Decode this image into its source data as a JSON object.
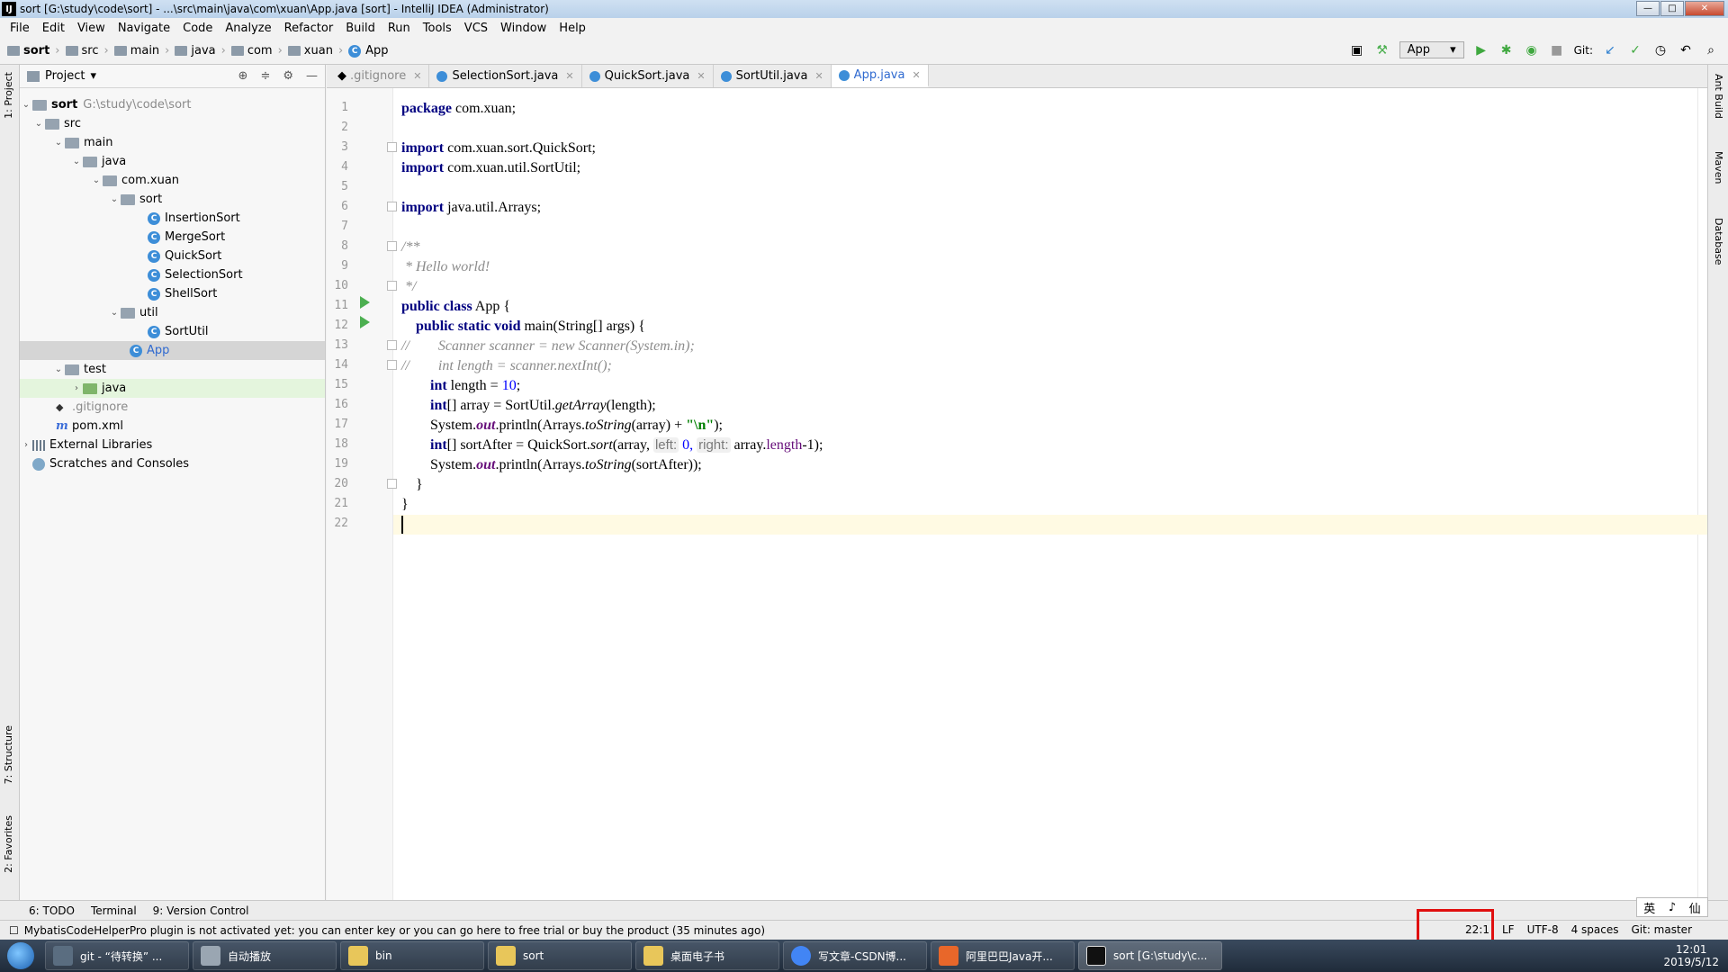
{
  "window": {
    "title": "sort [G:\\study\\code\\sort] - ...\\src\\main\\java\\com\\xuan\\App.java [sort] - IntelliJ IDEA (Administrator)"
  },
  "menu": [
    "File",
    "Edit",
    "View",
    "Navigate",
    "Code",
    "Analyze",
    "Refactor",
    "Build",
    "Run",
    "Tools",
    "VCS",
    "Window",
    "Help"
  ],
  "breadcrumbs": [
    "sort",
    "src",
    "main",
    "java",
    "com",
    "xuan",
    "App"
  ],
  "toolbar": {
    "run_config": "App",
    "git_label": "Git:"
  },
  "left_tabs": {
    "project": "1: Project",
    "structure": "7: Structure",
    "favorites": "2: Favorites"
  },
  "right_tabs": {
    "ant": "Ant Build",
    "maven": "Maven",
    "database": "Database"
  },
  "project_panel": {
    "title": "Project",
    "tree": [
      {
        "label": "sort",
        "path": "G:\\study\\code\\sort"
      },
      {
        "label": "src"
      },
      {
        "label": "main"
      },
      {
        "label": "java"
      },
      {
        "label": "com.xuan"
      },
      {
        "label": "sort"
      },
      {
        "label": "InsertionSort"
      },
      {
        "label": "MergeSort"
      },
      {
        "label": "QuickSort"
      },
      {
        "label": "SelectionSort"
      },
      {
        "label": "ShellSort"
      },
      {
        "label": "util"
      },
      {
        "label": "SortUtil"
      },
      {
        "label": "App"
      },
      {
        "label": "test"
      },
      {
        "label": "java"
      },
      {
        "label": ".gitignore"
      },
      {
        "label": "pom.xml"
      },
      {
        "label": "External Libraries"
      },
      {
        "label": "Scratches and Consoles"
      }
    ]
  },
  "editor_tabs": [
    ".gitignore",
    "SelectionSort.java",
    "QuickSort.java",
    "SortUtil.java",
    "App.java"
  ],
  "line_numbers": [
    "1",
    "2",
    "3",
    "4",
    "5",
    "6",
    "7",
    "8",
    "9",
    "10",
    "11",
    "12",
    "13",
    "14",
    "15",
    "16",
    "17",
    "18",
    "19",
    "20",
    "21",
    "22"
  ],
  "code": {
    "l1": [
      "package",
      " com.xuan;"
    ],
    "l3": [
      "import",
      " com.xuan.sort.QuickSort;"
    ],
    "l4": [
      "import",
      " com.xuan.util.SortUtil;"
    ],
    "l6": [
      "import",
      " java.util.Arrays;"
    ],
    "l8": "/**",
    "l9": " * Hello world!",
    "l10": " */",
    "l11": [
      "public class",
      " App {"
    ],
    "l12": [
      "    public static void",
      " main(String[] args) {"
    ],
    "l13": "//        Scanner scanner = new Scanner(System.in);",
    "l14": "//        int length = scanner.nextInt();",
    "l15": [
      "        int",
      " length = ",
      "10",
      ";"
    ],
    "l16": [
      "        int",
      "[] array = SortUtil.",
      "getArray",
      "(length);"
    ],
    "l17": [
      "        System.",
      "out",
      ".println(Arrays.",
      "toString",
      "(array) + ",
      "\"\\n\"",
      ");"
    ],
    "l18": [
      "        int",
      "[] sortAfter = QuickSort.",
      "sort",
      "(array, ",
      "left:",
      " 0, ",
      "right:",
      " array.",
      "length",
      "-1);"
    ],
    "l19": [
      "        System.",
      "out",
      ".println(Arrays.",
      "toString",
      "(sortAfter));"
    ],
    "l20": "    }",
    "l21": "}"
  },
  "bottom_tools": [
    "6: TODO",
    "Terminal",
    "9: Version Control"
  ],
  "status": {
    "message": "MybatisCodeHelperPro plugin is not activated yet: you can enter key or you can go here to free trial or buy the product (35 minutes ago)",
    "position": "22:1",
    "line_sep": "LF",
    "encoding": "UTF-8",
    "indent": "4 spaces",
    "git": "Git: master"
  },
  "ime": [
    "英",
    "♪",
    "仙"
  ],
  "taskbar": [
    {
      "label": "git - “待转换” ...",
      "color": "#5a6d80"
    },
    {
      "label": "自动播放",
      "color": "#9aa6b2"
    },
    {
      "label": "bin",
      "color": "#e8c65a"
    },
    {
      "label": "sort",
      "color": "#e8c65a"
    },
    {
      "label": "桌面电子书",
      "color": "#e8c65a"
    },
    {
      "label": "写文章-CSDN博...",
      "color": "#4285f4"
    },
    {
      "label": "阿里巴巴Java开...",
      "color": "#e8672a"
    },
    {
      "label": "sort [G:\\study\\c...",
      "color": "#111111"
    }
  ],
  "clock": {
    "time": "12:01",
    "date": "2019/5/12"
  }
}
